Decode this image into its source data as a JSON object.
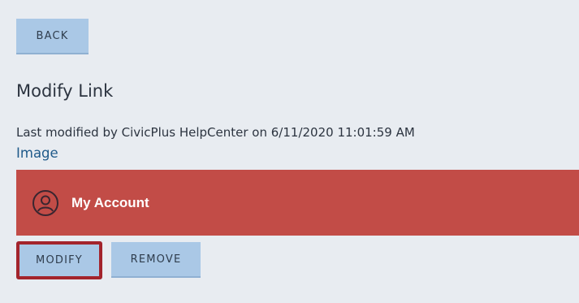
{
  "toolbar": {
    "back_label": "BACK"
  },
  "page": {
    "title": "Modify Link",
    "last_modified": "Last modified by CivicPlus HelpCenter on 6/11/2020 11:01:59 AM",
    "image_link": "Image"
  },
  "preview": {
    "icon": "user-circle-icon",
    "label": "My Account",
    "background_color": "#c24c47"
  },
  "actions": {
    "modify_label": "MODIFY",
    "remove_label": "REMOVE"
  }
}
